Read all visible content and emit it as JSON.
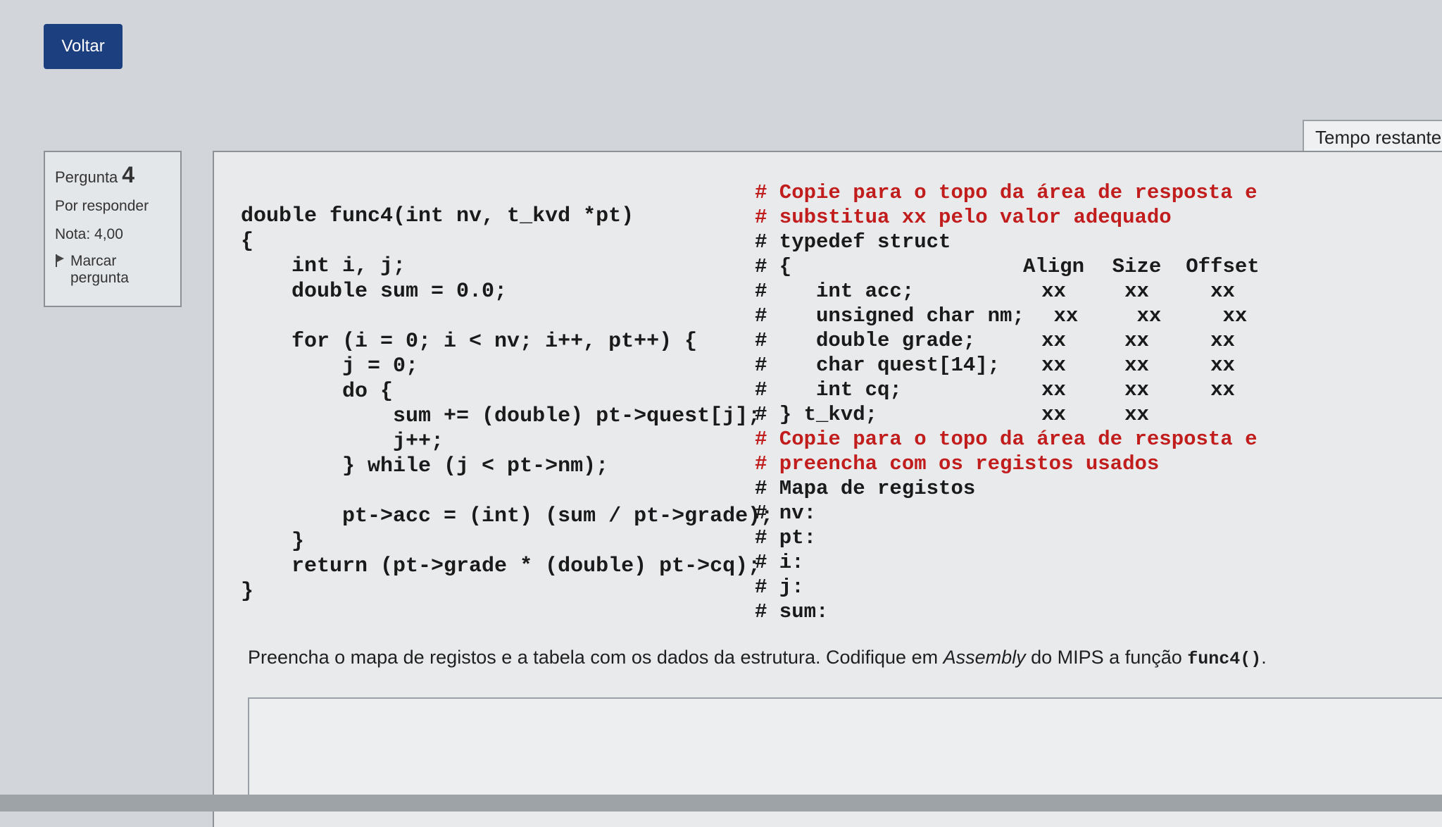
{
  "nav": {
    "back_label": "Voltar"
  },
  "timer": {
    "label": "Tempo restante"
  },
  "question_info": {
    "prefix": "Pergunta",
    "number": "4",
    "status": "Por responder",
    "grade": "Nota: 4,00",
    "flag_label_1": "Marcar",
    "flag_label_2": "pergunta"
  },
  "code_left": [
    "double func4(int nv, t_kvd *pt)",
    "{",
    "    int i, j;",
    "    double sum = 0.0;",
    "",
    "    for (i = 0; i < nv; i++, pt++) {",
    "        j = 0;",
    "        do {",
    "            sum += (double) pt->quest[j];",
    "            j++;",
    "        } while (j < pt->nm);",
    "",
    "        pt->acc = (int) (sum / pt->grade);",
    "    }",
    "    return (pt->grade * (double) pt->cq);",
    "}"
  ],
  "code_right": {
    "comment1": [
      "# Copie para o topo da área de resposta e",
      "# substitua xx pelo valor adequado"
    ],
    "typedef_line": "# typedef struct",
    "brace_open": "# {",
    "headers": [
      "Align",
      "Size",
      "Offset"
    ],
    "fields": [
      {
        "decl": "int acc;",
        "align": "xx",
        "size": "xx",
        "offset": "xx"
      },
      {
        "decl": "unsigned char nm;",
        "align": "xx",
        "size": "xx",
        "offset": "xx"
      },
      {
        "decl": "double grade;",
        "align": "xx",
        "size": "xx",
        "offset": "xx"
      },
      {
        "decl": "char quest[14];",
        "align": "xx",
        "size": "xx",
        "offset": "xx"
      },
      {
        "decl": "int cq;",
        "align": "xx",
        "size": "xx",
        "offset": "xx"
      }
    ],
    "closing": {
      "decl": "# } t_kvd;",
      "align": "xx",
      "size": "xx"
    },
    "comment2": [
      "# Copie para o topo da área de resposta e",
      "# preencha com os registos usados"
    ],
    "map_title": "# Mapa de registos",
    "map_entries": [
      "# nv:",
      "# pt:",
      "# i:",
      "# j:",
      "# sum:"
    ]
  },
  "instruction": {
    "part1": "Preencha o mapa de registos e a tabela com os dados da estrutura. Codifique em ",
    "italic": "Assembly",
    "part2": " do MIPS a função ",
    "code": "func4()",
    "part3": "."
  }
}
